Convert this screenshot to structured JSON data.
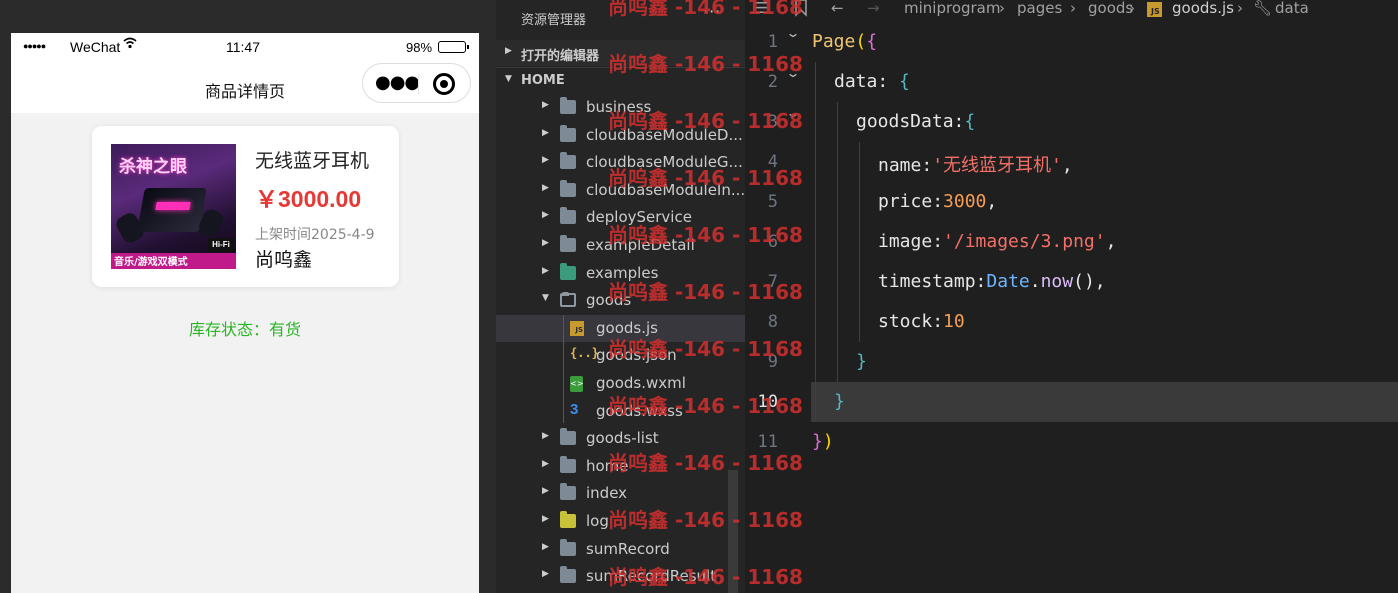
{
  "simulator": {
    "statusbar": {
      "signal": "●●●●●",
      "carrier": "WeChat",
      "time": "11:47",
      "battery_percent": "98%",
      "battery_level": 0.98
    },
    "navbar": {
      "title": "商品详情页"
    },
    "product": {
      "name": "无线蓝牙耳机",
      "price": "￥3000.00",
      "time": "上架时间2025-4-9",
      "shop": "尚呜鑫",
      "image": {
        "title": "杀神之眼",
        "caption": "音乐/游戏双模式",
        "badge": "Hi-Fi"
      }
    },
    "stock_status": "库存状态：有货"
  },
  "explorer": {
    "title": "资源管理器",
    "more": "···",
    "open_editors": "打开的编辑器",
    "home": "HOME",
    "tree": [
      {
        "name": "business",
        "type": "folder"
      },
      {
        "name": "cloudbaseModuleD...",
        "type": "folder"
      },
      {
        "name": "cloudbaseModuleG...",
        "type": "folder"
      },
      {
        "name": "cloudbaseModuleIn...",
        "type": "folder"
      },
      {
        "name": "deployService",
        "type": "folder"
      },
      {
        "name": "exampleDetail",
        "type": "folder"
      },
      {
        "name": "examples",
        "type": "folder"
      },
      {
        "name": "goods",
        "type": "folder-open"
      },
      {
        "name": "goods.js",
        "type": "js"
      },
      {
        "name": "goods.json",
        "type": "json"
      },
      {
        "name": "goods.wxml",
        "type": "wxml"
      },
      {
        "name": "goods.wxss",
        "type": "wxss"
      },
      {
        "name": "goods-list",
        "type": "folder"
      },
      {
        "name": "home",
        "type": "folder"
      },
      {
        "name": "index",
        "type": "folder"
      },
      {
        "name": "log",
        "type": "folder"
      },
      {
        "name": "sumRecord",
        "type": "folder"
      },
      {
        "name": "sumRecordResult",
        "type": "folder"
      }
    ]
  },
  "editor": {
    "breadcrumb": [
      "miniprogram",
      "pages",
      "goods",
      "goods.js",
      "data"
    ],
    "line_numbers": [
      "1",
      "2",
      "3",
      "4",
      "5",
      "6",
      "7",
      "8",
      "9",
      "10",
      "11"
    ],
    "code": {
      "l1_fn": "Page",
      "l2_key": "data",
      "l3_key": "goodsData",
      "l4_key": "name",
      "l4_val": "'无线蓝牙耳机'",
      "l5_key": "price",
      "l5_val": "3000",
      "l6_key": "image",
      "l6_val": "'/images/3.png'",
      "l7_key": "timestamp",
      "l7_obj": "Date",
      "l7_meth": "now",
      "l8_key": "stock",
      "l8_val": "10"
    }
  },
  "watermark": "尚呜鑫 -146 - 1168"
}
